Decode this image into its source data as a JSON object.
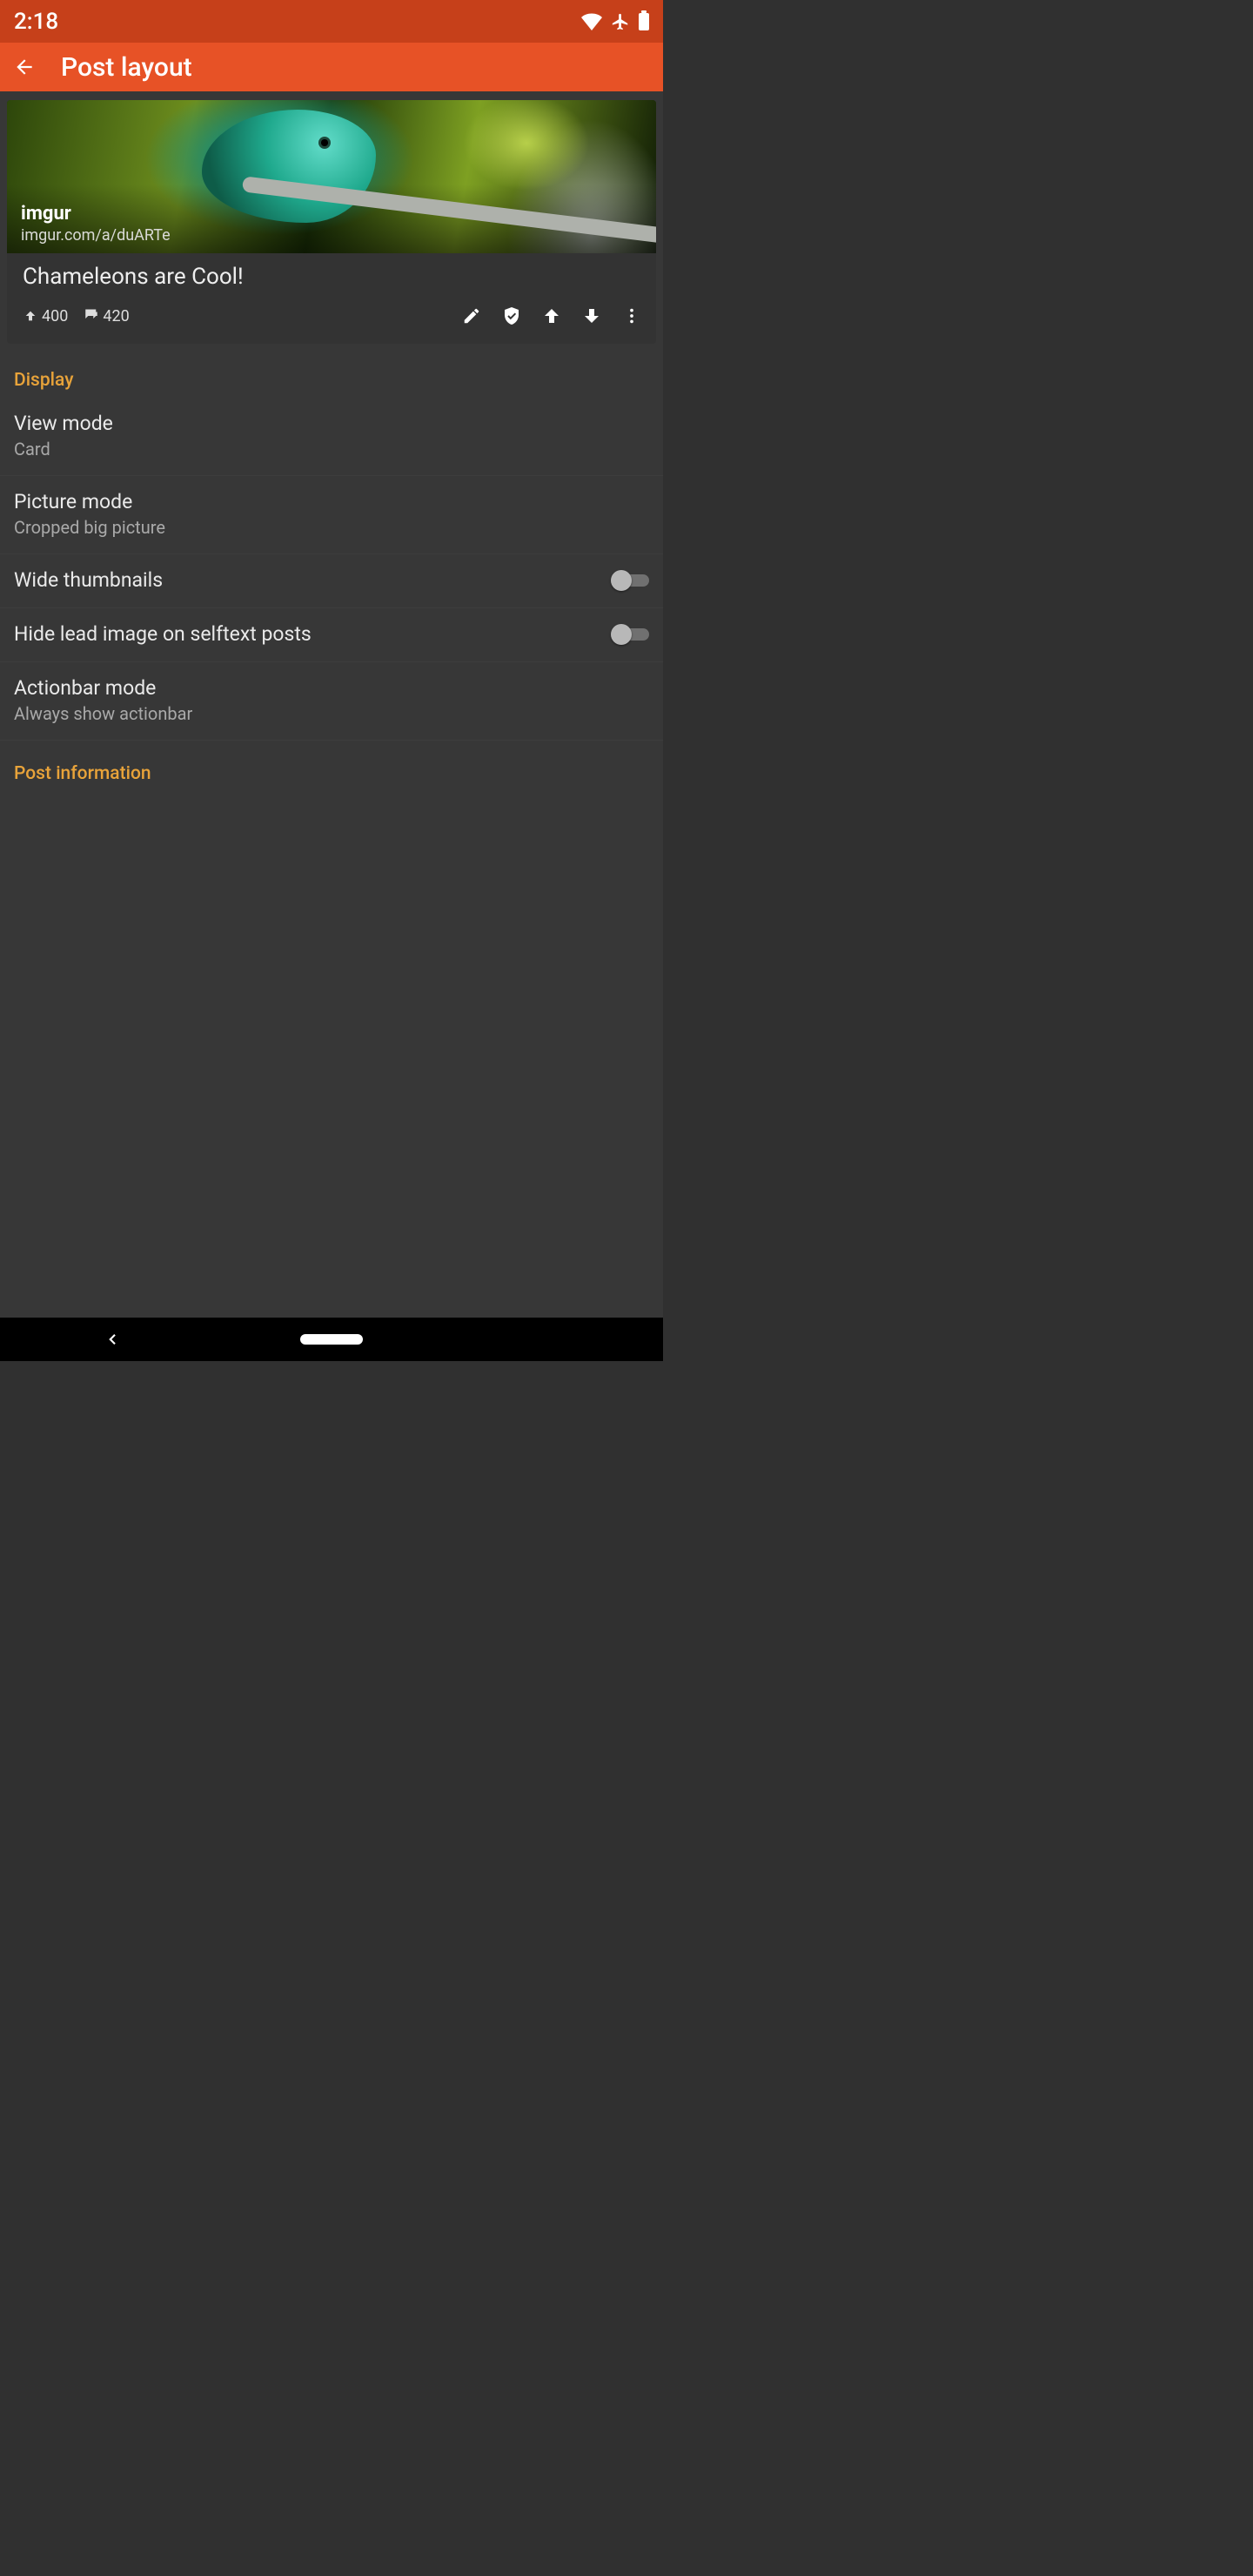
{
  "status": {
    "time": "2:18"
  },
  "appbar": {
    "title": "Post layout"
  },
  "preview": {
    "source_name": "imgur",
    "source_url": "imgur.com/a/duARTe",
    "title": "Chameleons are Cool!",
    "upvotes": "400",
    "comments": "420"
  },
  "sections": {
    "display": {
      "header": "Display",
      "view_mode": {
        "title": "View mode",
        "value": "Card"
      },
      "picture_mode": {
        "title": "Picture mode",
        "value": "Cropped big picture"
      },
      "wide_thumbnails": {
        "title": "Wide thumbnails",
        "on": false
      },
      "hide_lead": {
        "title": "Hide lead image on selftext posts",
        "on": false
      },
      "actionbar_mode": {
        "title": "Actionbar mode",
        "value": "Always show actionbar"
      }
    },
    "post_info": {
      "header": "Post information"
    }
  }
}
